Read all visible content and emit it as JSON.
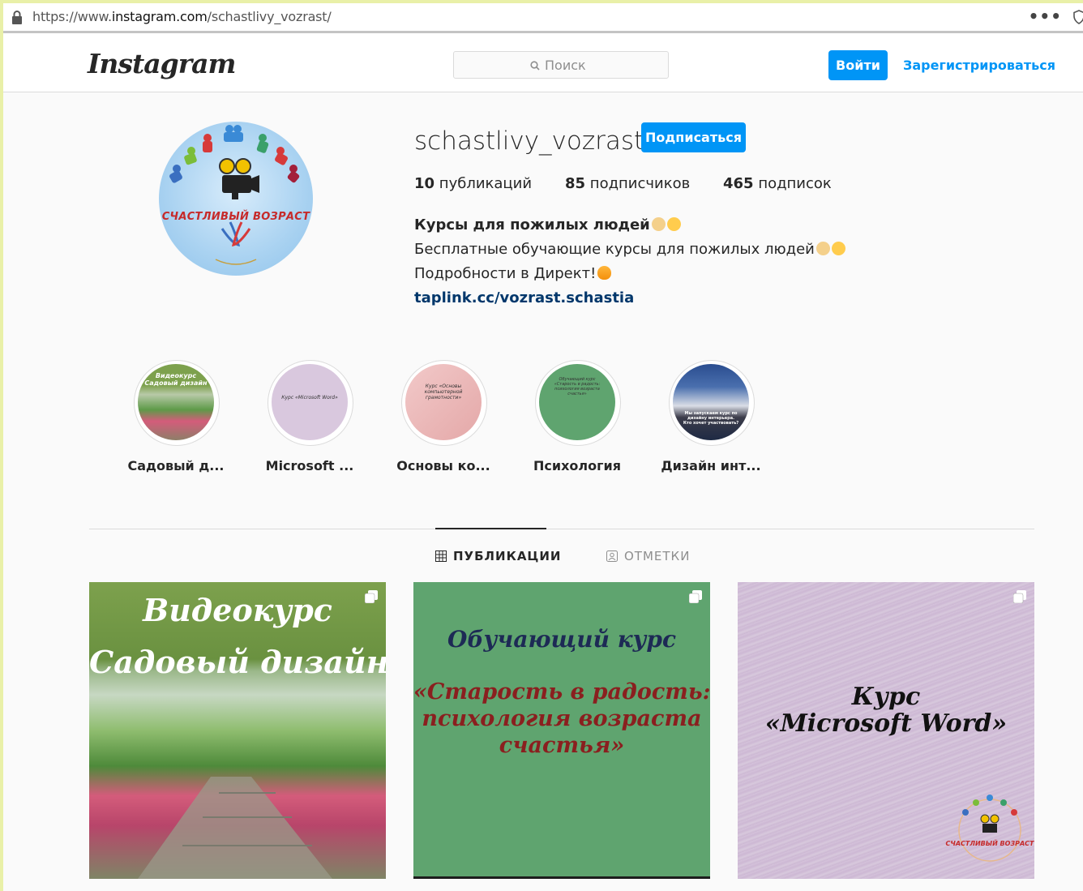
{
  "browser": {
    "url_prefix": "https://www.",
    "url_host": "instagram.com",
    "url_path": "/schastlivy_vozrast/",
    "menu_glyph": "•••"
  },
  "header": {
    "logo": "Instagram",
    "search_placeholder": "Поиск",
    "login_label": "Войти",
    "register_label": "Зарегистрироваться"
  },
  "profile": {
    "username": "schastlivy_vozrast",
    "follow_label": "Подписаться",
    "avatar_text": "СЧАСТЛИВЫЙ ВОЗРАСТ",
    "stats": {
      "posts_count": "10",
      "posts_label": "публикаций",
      "followers_count": "85",
      "followers_label": "подписчиков",
      "following_count": "465",
      "following_label": "подписок"
    },
    "bio": {
      "name": "Курсы для пожилых людей",
      "line1": "Бесплатные обучающие курсы для пожилых людей",
      "line2": "Подробности в Директ!",
      "link": "taplink.cc/vozrast.schastia"
    }
  },
  "highlights": [
    {
      "label": "Садовый д...",
      "cover_text": "Видеокурс Садовый дизайн"
    },
    {
      "label": "Microsoft ...",
      "cover_text": "Курс «Microsoft Word»"
    },
    {
      "label": "Основы ко...",
      "cover_text": "Курс «Основы компьютерной грамотности»"
    },
    {
      "label": "Психология",
      "cover_text": "Обучающий курс «Старость в радость: психология возраста счастья»"
    },
    {
      "label": "Дизайн инт...",
      "cover_text": "Мы запускаем курс по дизайну интерьера. Кто хочет участвовать?"
    }
  ],
  "tabs": {
    "posts": "ПУБЛИКАЦИИ",
    "tagged": "ОТМЕТКИ"
  },
  "posts": [
    {
      "line1": "Видеокурс",
      "line2": "Садовый дизайн"
    },
    {
      "line1": "Обучающий курс",
      "line2": "«Старость в радость:",
      "line3": "психология возраста",
      "line4": "счастья»"
    },
    {
      "line1": "Курс",
      "line2": "«Microsoft Word»",
      "badge": "СЧАСТЛИВЫЙ ВОЗРАСТ"
    }
  ],
  "colors": {
    "primary_blue": "#0095f6",
    "link_dark_blue": "#00376b",
    "text": "#262626",
    "muted": "#8e8e8e"
  }
}
